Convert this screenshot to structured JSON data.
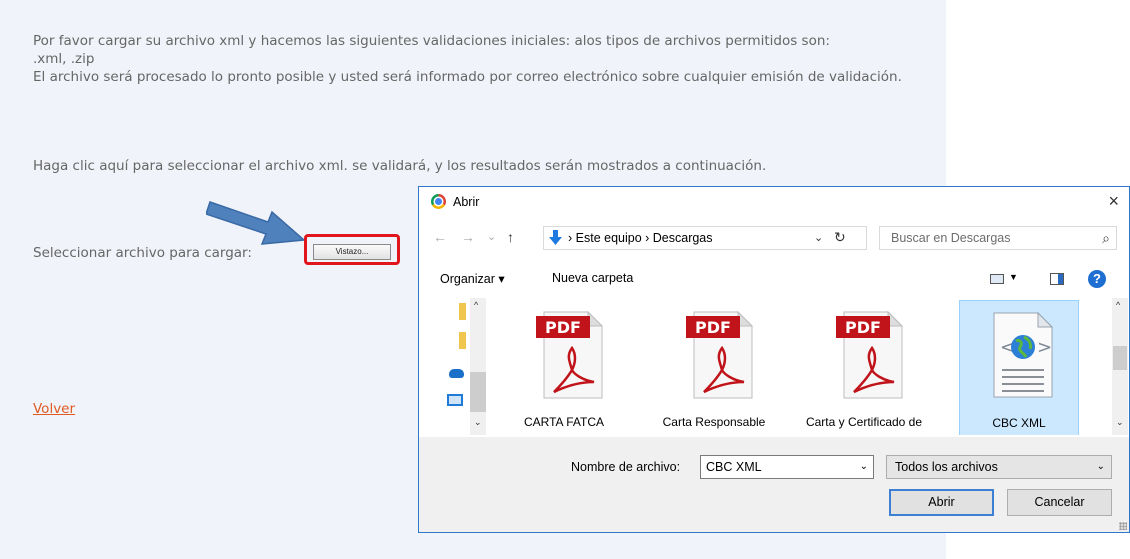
{
  "page": {
    "intro_line1": "Por favor cargar su archivo xml y hacemos las siguientes validaciones iniciales: alos tipos de archivos permitidos son:",
    "intro_line2": ".xml, .zip",
    "intro_line3": "El archivo será procesado lo pronto posible y usted será informado por correo electrónico sobre cualquier emisión de validación.",
    "hint": "Haga clic aquí para seleccionar el archivo xml. se validará, y los resultados serán mostrados a continuación.",
    "select_label": "Seleccionar archivo para cargar:",
    "browse_button": "Vistazo...",
    "back_link": "Volver",
    "link_color": "#e05a22",
    "highlight_color": "#e1161c",
    "arrow_color": "#4f81bd"
  },
  "dialog": {
    "title": "Abrir",
    "close_symbol": "×",
    "nav": {
      "back": "←",
      "forward": "→",
      "recent": "⌄",
      "up": "↑"
    },
    "address": {
      "path": "›  Este equipo  ›  Descargas",
      "dropdown": "⌄",
      "refresh": "↻"
    },
    "search_placeholder": "Buscar en Descargas",
    "search_symbol": "⌕",
    "toolbar": {
      "organize": "Organizar ▾",
      "new_folder": "Nueva carpeta",
      "view_chevron": "▼",
      "help": "?"
    },
    "files": [
      {
        "name": "CARTA FATCA",
        "type": "pdf",
        "selected": false
      },
      {
        "name": "Carta Responsable",
        "type": "pdf",
        "selected": false
      },
      {
        "name": "Carta y Certificado de",
        "type": "pdf",
        "selected": false
      },
      {
        "name": "CBC XML",
        "type": "xml",
        "selected": true
      }
    ],
    "pdf_badge": "PDF",
    "scroll_up": "^",
    "scroll_down": "⌄",
    "filename_label": "Nombre de archivo:",
    "filename_value": "CBC XML",
    "file_type": "Todos los archivos",
    "open_button": "Abrir",
    "cancel_button": "Cancelar",
    "select_chevron": "⌄"
  }
}
